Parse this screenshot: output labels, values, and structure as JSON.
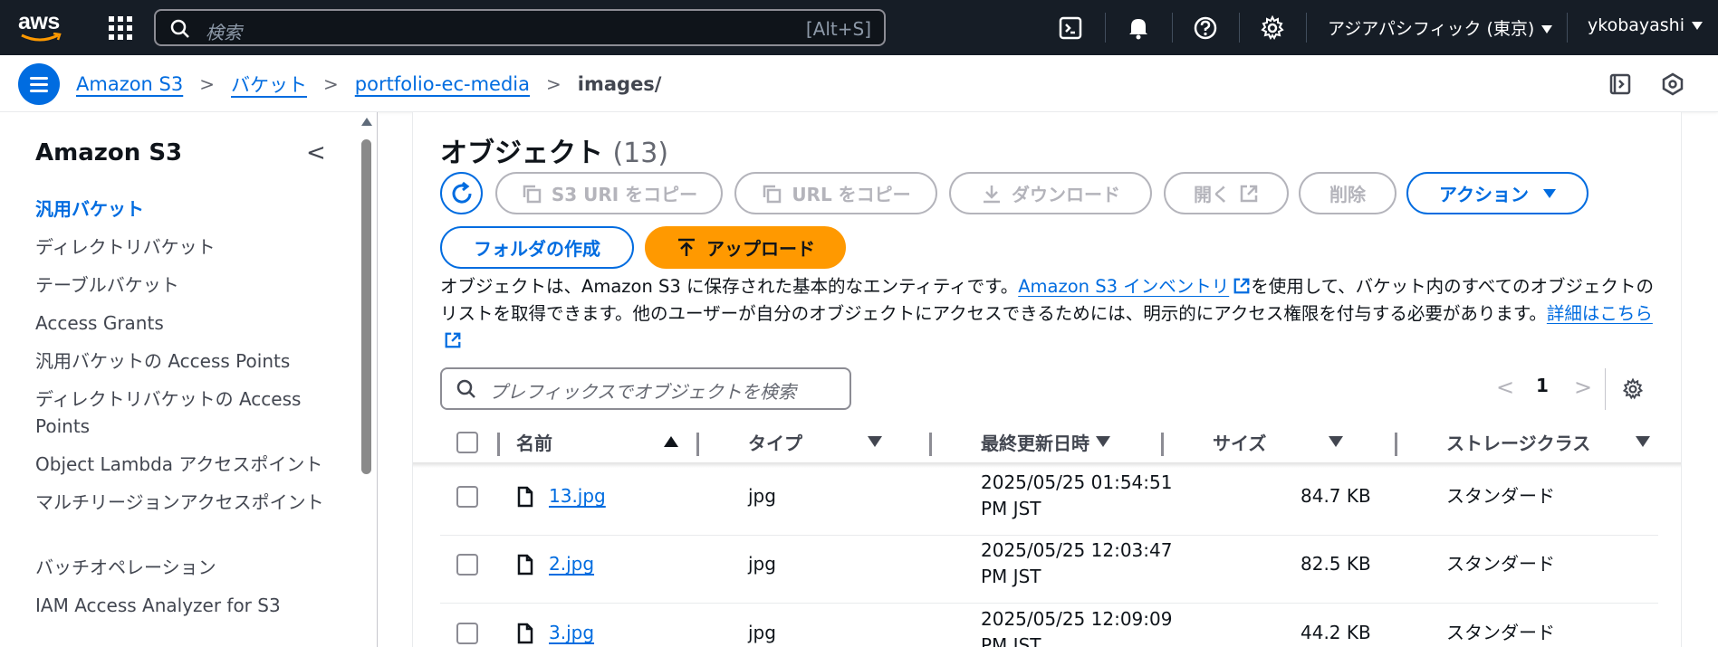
{
  "topnav": {
    "logo_text": "aws",
    "search_placeholder": "検索",
    "search_shortcut": "[Alt+S]",
    "region": "アジアパシフィック (東京)",
    "user": "ykobayashi"
  },
  "breadcrumb": {
    "items": [
      "Amazon S3",
      "バケット",
      "portfolio-ec-media"
    ],
    "current": "images/"
  },
  "sidebar": {
    "title": "Amazon S3",
    "items": [
      "汎用バケット",
      "ディレクトリバケット",
      "テーブルバケット",
      "Access Grants",
      "汎用バケットの Access Points",
      "ディレクトリバケットの Access Points",
      "Object Lambda アクセスポイント",
      "マルチリージョンアクセスポイント",
      "バッチオペレーション",
      "IAM Access Analyzer for S3"
    ]
  },
  "main": {
    "title": "オブジェクト",
    "count": "(13)",
    "buttons": {
      "copy_s3_uri": "S3 URI をコピー",
      "copy_url": "URL をコピー",
      "download": "ダウンロード",
      "open": "開く",
      "delete": "削除",
      "actions": "アクション",
      "create_folder": "フォルダの作成",
      "upload": "アップロード"
    },
    "description": {
      "part1": "オブジェクトは、Amazon S3 に保存された基本的なエンティティです。",
      "link1": "Amazon S3 インベントリ",
      "part2": "を使用して、バケット内のすべてのオブジェクトのリストを取得できます。他のユーザーが自分のオブジェクトにアクセスできるためには、明示的にアクセス権限を付与する必要があります。",
      "link2": "詳細はこちら"
    },
    "filter_placeholder": "プレフィックスでオブジェクトを検索",
    "page": "1",
    "columns": [
      "名前",
      "タイプ",
      "最終更新日時",
      "サイズ",
      "ストレージクラス"
    ],
    "rows": [
      {
        "name": "13.jpg",
        "type": "jpg",
        "date1": "2025/05/25 01:54:51",
        "date2": "PM JST",
        "size": "84.7 KB",
        "storage": "スタンダード"
      },
      {
        "name": "2.jpg",
        "type": "jpg",
        "date1": "2025/05/25 12:03:47",
        "date2": "PM JST",
        "size": "82.5 KB",
        "storage": "スタンダード"
      },
      {
        "name": "3.jpg",
        "type": "jpg",
        "date1": "2025/05/25 12:09:09",
        "date2": "PM JST",
        "size": "44.2 KB",
        "storage": "スタンダード"
      }
    ]
  },
  "colors": {
    "accent": "#006ce0",
    "upload": "#ff9900",
    "topnav_bg": "#161d26"
  }
}
